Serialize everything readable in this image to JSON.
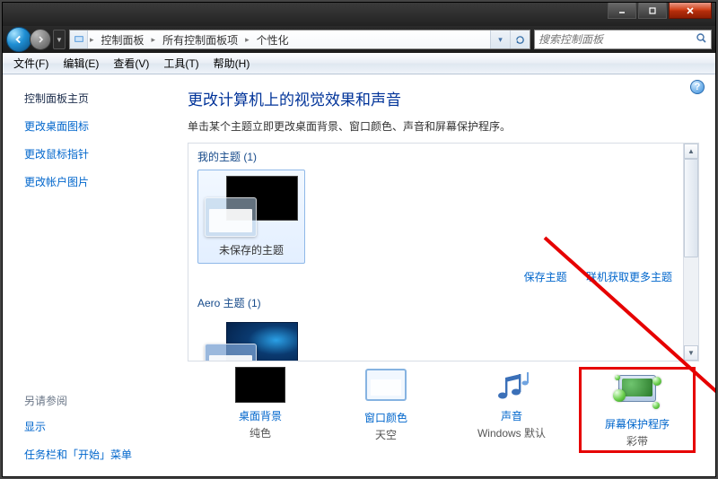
{
  "breadcrumb": {
    "seg1": "控制面板",
    "seg2": "所有控制面板项",
    "seg3": "个性化"
  },
  "search": {
    "placeholder": "搜索控制面板"
  },
  "menu": {
    "file": "文件(F)",
    "edit": "编辑(E)",
    "view": "查看(V)",
    "tools": "工具(T)",
    "help": "帮助(H)"
  },
  "sidebar": {
    "home": "控制面板主页",
    "links": {
      "desktop_icons": "更改桌面图标",
      "mouse_pointers": "更改鼠标指针",
      "account_picture": "更改帐户图片"
    },
    "see_also_label": "另请参阅",
    "see_also": {
      "display": "显示",
      "taskbar": "任务栏和「开始」菜单"
    }
  },
  "main": {
    "title": "更改计算机上的视觉效果和声音",
    "desc": "单击某个主题立即更改桌面背景、窗口颜色、声音和屏幕保护程序。",
    "my_themes": {
      "label": "我的主题 (1)",
      "unsaved": "未保存的主题"
    },
    "aero_themes_label": "Aero 主题 (1)",
    "actions": {
      "save": "保存主题",
      "more": "联机获取更多主题"
    }
  },
  "bottom": {
    "bg": {
      "title": "桌面背景",
      "sub": "纯色"
    },
    "color": {
      "title": "窗口颜色",
      "sub": "天空"
    },
    "sound": {
      "title": "声音",
      "sub": "Windows 默认"
    },
    "ss": {
      "title": "屏幕保护程序",
      "sub": "彩带"
    }
  }
}
